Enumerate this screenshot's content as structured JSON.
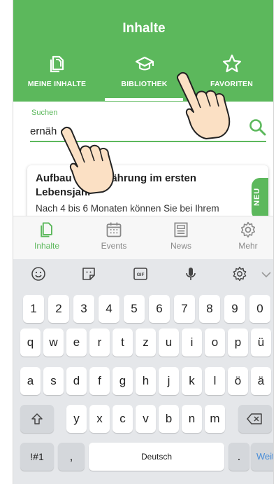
{
  "header": {
    "title": "Inhalte",
    "tabs": [
      {
        "label": "MEINE INHALTE",
        "icon": "documents-icon"
      },
      {
        "label": "BIBLIOTHEK",
        "icon": "graduation-cap-icon",
        "active": true
      },
      {
        "label": "FAVORITEN",
        "icon": "star-icon"
      }
    ]
  },
  "search": {
    "label": "Suchen",
    "value": "ernäh"
  },
  "card": {
    "title": "Aufbau der Ernährung im ersten Lebensjahr",
    "text": "Nach 4 bis 6 Monaten können Sie bei Ihrem",
    "badge": "NEU"
  },
  "bottom_nav": [
    {
      "label": "Inhalte",
      "icon": "documents-icon",
      "active": true
    },
    {
      "label": "Events",
      "icon": "calendar-icon"
    },
    {
      "label": "News",
      "icon": "newspaper-icon"
    },
    {
      "label": "Mehr",
      "icon": "gear-icon"
    }
  ],
  "keyboard": {
    "row_numbers": [
      "1",
      "2",
      "3",
      "4",
      "5",
      "6",
      "7",
      "8",
      "9",
      "0"
    ],
    "row_1": [
      "q",
      "w",
      "e",
      "r",
      "t",
      "z",
      "u",
      "i",
      "o",
      "p",
      "ü"
    ],
    "row_2": [
      "a",
      "s",
      "d",
      "f",
      "g",
      "h",
      "j",
      "k",
      "l",
      "ö",
      "ä"
    ],
    "row_3": [
      "y",
      "x",
      "c",
      "v",
      "b",
      "n",
      "m"
    ],
    "symbols_label": "!#1",
    "comma": ",",
    "space_label": "Deutsch",
    "period": ".",
    "enter_label": "Weiter"
  },
  "colors": {
    "brand_green": "#5cb85c",
    "keyboard_bg": "#e5e7ea"
  }
}
